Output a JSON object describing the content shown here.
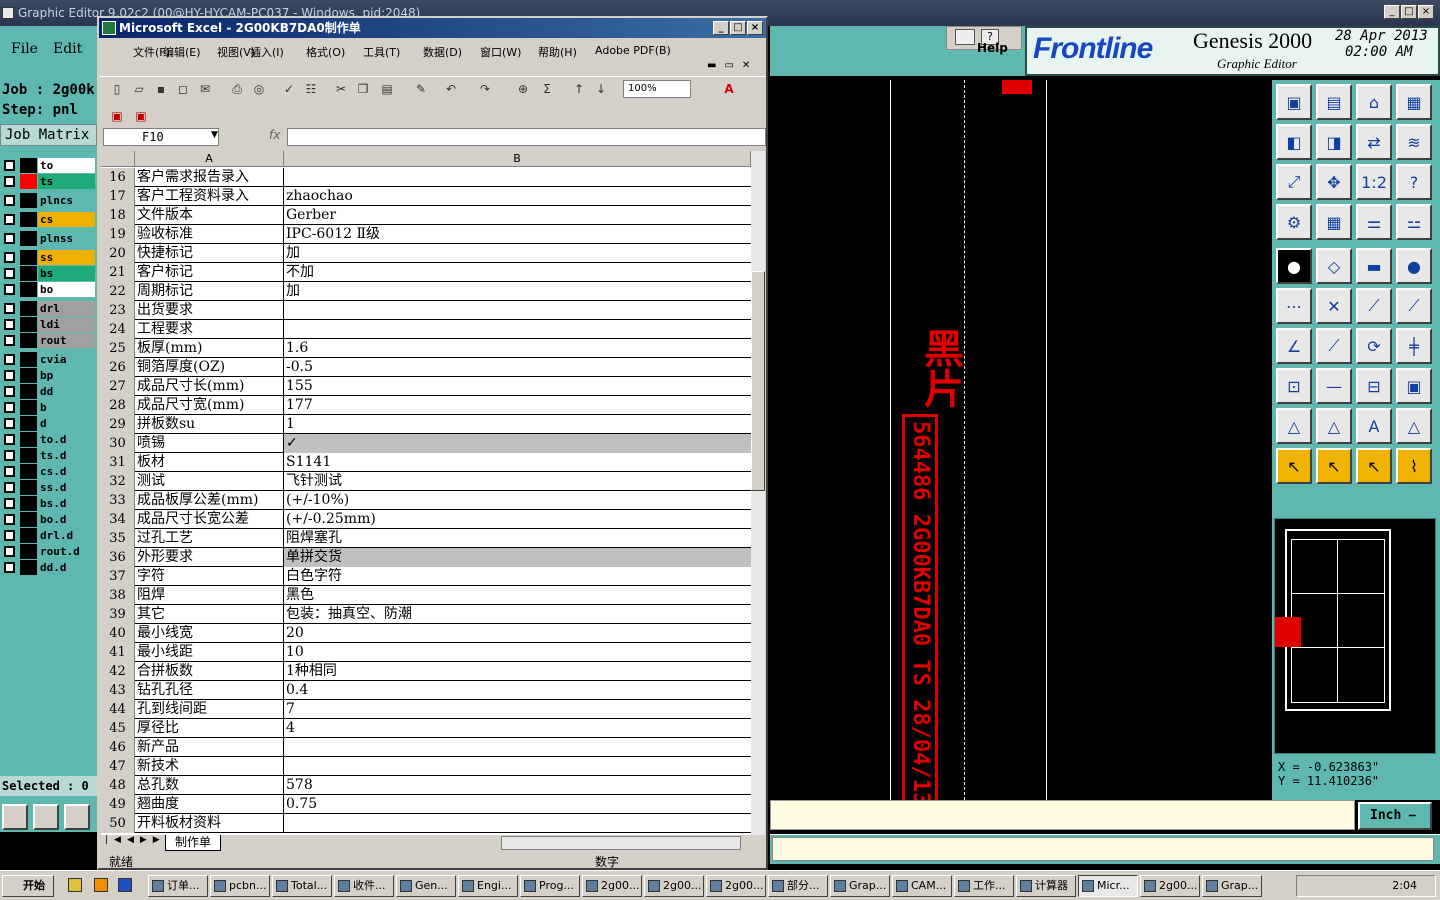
{
  "genesis": {
    "window_title": "Graphic Editor 9.02c2 (00@HY-HYCAM-PC037 - Windows, pid:2048)",
    "menu_file": "File",
    "menu_edit": "Edit",
    "job_label": "Job : 2g00k",
    "step_label": "Step: pnl",
    "job_matrix": "Job Matrix",
    "help_label": "Help",
    "brand": "Frontline",
    "product": "Genesis 2000",
    "subtitle": "Graphic Editor",
    "date": "28 Apr 2013",
    "time": "02:00 AM",
    "selected": "Selected : 0",
    "coord_x": "X = -0.623863\"",
    "coord_y": "Y = 11.410236\"",
    "units": "Inch",
    "canvas_text": "黑片",
    "canvas_vertical_text": "564486 2G00KB7DA0 TS 28/04/13",
    "layers": [
      {
        "name": "to",
        "color": "#ffffff",
        "swatch": "#000000"
      },
      {
        "name": "ts",
        "color": "#1faa7a",
        "swatch": "#ff0000"
      },
      {
        "name": "plncs",
        "color": "#5fb8b0",
        "swatch": "#000000"
      },
      {
        "name": "cs",
        "color": "#f0b000",
        "swatch": "#000000"
      },
      {
        "name": "plnss",
        "color": "#5fb8b0",
        "swatch": "#000000"
      },
      {
        "name": "ss",
        "color": "#f0b000",
        "swatch": "#000000"
      },
      {
        "name": "bs",
        "color": "#1faa7a",
        "swatch": "#000000"
      },
      {
        "name": "bo",
        "color": "#ffffff",
        "swatch": "#000000"
      },
      {
        "name": "drl",
        "color": "#a0a0a0",
        "swatch": "#000000"
      },
      {
        "name": "ldi",
        "color": "#a0a0a0",
        "swatch": "#000000"
      },
      {
        "name": "rout",
        "color": "#a0a0a0",
        "swatch": "#000000"
      },
      {
        "name": "cvia",
        "color": "#5fb8b0",
        "swatch": "#000000"
      },
      {
        "name": "bp",
        "color": "#5fb8b0",
        "swatch": "#000000"
      },
      {
        "name": "dd",
        "color": "#5fb8b0",
        "swatch": "#000000"
      },
      {
        "name": "b",
        "color": "#5fb8b0",
        "swatch": "#000000"
      },
      {
        "name": "d",
        "color": "#5fb8b0",
        "swatch": "#000000"
      },
      {
        "name": "to.d",
        "color": "#5fb8b0",
        "swatch": "#000000"
      },
      {
        "name": "ts.d",
        "color": "#5fb8b0",
        "swatch": "#000000"
      },
      {
        "name": "cs.d",
        "color": "#5fb8b0",
        "swatch": "#000000"
      },
      {
        "name": "ss.d",
        "color": "#5fb8b0",
        "swatch": "#000000"
      },
      {
        "name": "bs.d",
        "color": "#5fb8b0",
        "swatch": "#000000"
      },
      {
        "name": "bo.d",
        "color": "#5fb8b0",
        "swatch": "#000000"
      },
      {
        "name": "drl.d",
        "color": "#5fb8b0",
        "swatch": "#000000"
      },
      {
        "name": "rout.d",
        "color": "#5fb8b0",
        "swatch": "#000000"
      },
      {
        "name": "dd.d",
        "color": "#5fb8b0",
        "swatch": "#000000"
      }
    ]
  },
  "excel": {
    "window_title": "Microsoft Excel - 2G00KB7DA0制作单",
    "menus": [
      "文件(F)",
      "编辑(E)",
      "视图(V)",
      "插入(I)",
      "格式(O)",
      "工具(T)",
      "数据(D)",
      "窗口(W)",
      "帮助(H)",
      "Adobe PDF(B)"
    ],
    "zoom": "100%",
    "name_box": "F10",
    "fx": "fx",
    "col_a": "A",
    "col_b": "B",
    "sheet_tab": "制作单",
    "status_ready": "就绪",
    "status_num": "数字",
    "rows": [
      {
        "n": "16",
        "a": "客户需求报告录入",
        "b": "",
        "hl": false
      },
      {
        "n": "17",
        "a": "客户工程资料录入",
        "b": "zhaochao",
        "hl": false
      },
      {
        "n": "18",
        "a": "文件版本",
        "b": "Gerber",
        "hl": false
      },
      {
        "n": "19",
        "a": "验收标准",
        "b": "IPC-6012 Ⅱ级",
        "hl": false
      },
      {
        "n": "20",
        "a": "快捷标记",
        "b": "加",
        "hl": false
      },
      {
        "n": "21",
        "a": "客户标记",
        "b": "不加",
        "hl": false
      },
      {
        "n": "22",
        "a": "周期标记",
        "b": "加",
        "hl": false
      },
      {
        "n": "23",
        "a": "出货要求",
        "b": "",
        "hl": false
      },
      {
        "n": "24",
        "a": "工程要求",
        "b": "",
        "hl": false
      },
      {
        "n": "25",
        "a": "板厚(mm)",
        "b": "1.6",
        "hl": false
      },
      {
        "n": "26",
        "a": "铜箔厚度(OZ)",
        "b": "-0.5",
        "hl": false
      },
      {
        "n": "27",
        "a": "成品尺寸长(mm)",
        "b": "155",
        "hl": false
      },
      {
        "n": "28",
        "a": "成品尺寸宽(mm)",
        "b": "177",
        "hl": false
      },
      {
        "n": "29",
        "a": "拼板数su",
        "b": "1",
        "hl": false
      },
      {
        "n": "30",
        "a": "喷锡",
        "b": "✓",
        "hl": true
      },
      {
        "n": "31",
        "a": "板材",
        "b": "S1141",
        "hl": false
      },
      {
        "n": "32",
        "a": "测试",
        "b": "飞针测试",
        "hl": false
      },
      {
        "n": "33",
        "a": "成品板厚公差(mm)",
        "b": "(+/-10%)",
        "hl": false
      },
      {
        "n": "34",
        "a": "成品尺寸长宽公差",
        "b": "(+/-0.25mm)",
        "hl": false
      },
      {
        "n": "35",
        "a": "过孔工艺",
        "b": "阻焊塞孔",
        "hl": false
      },
      {
        "n": "36",
        "a": "外形要求",
        "b": "单拼交货",
        "hl": true
      },
      {
        "n": "37",
        "a": "字符",
        "b": "白色字符",
        "hl": false
      },
      {
        "n": "38",
        "a": "阻焊",
        "b": "黑色",
        "hl": false
      },
      {
        "n": "39",
        "a": "其它",
        "b": "包装：抽真空、防潮",
        "hl": false
      },
      {
        "n": "40",
        "a": "最小线宽",
        "b": "20",
        "hl": false
      },
      {
        "n": "41",
        "a": "最小线距",
        "b": "10",
        "hl": false
      },
      {
        "n": "42",
        "a": "合拼板数",
        "b": "1种相同",
        "hl": false
      },
      {
        "n": "43",
        "a": "钻孔孔径",
        "b": "0.4",
        "hl": false
      },
      {
        "n": "44",
        "a": "孔到线间距",
        "b": "7",
        "hl": false
      },
      {
        "n": "45",
        "a": "厚径比",
        "b": "4",
        "hl": false
      },
      {
        "n": "46",
        "a": "新产品",
        "b": "",
        "hl": false
      },
      {
        "n": "47",
        "a": "新技术",
        "b": "",
        "hl": false
      },
      {
        "n": "48",
        "a": "总孔数",
        "b": "578",
        "hl": false
      },
      {
        "n": "49",
        "a": "翘曲度",
        "b": "0.75",
        "hl": false
      },
      {
        "n": "50",
        "a": "开料板材资料",
        "b": "",
        "hl": false
      }
    ]
  },
  "taskbar": {
    "start": "开始",
    "tasks": [
      "订单...",
      "pcbn...",
      "Total...",
      "收件...",
      "Gen...",
      "Engi...",
      "Prog...",
      "2g00...",
      "2g00...",
      "2g00...",
      "部分...",
      "Grap...",
      "CAM...",
      "工作...",
      "计算器",
      "Micr...",
      "2g00...",
      "Grap..."
    ],
    "active_index": 15,
    "clock": "2:04"
  }
}
